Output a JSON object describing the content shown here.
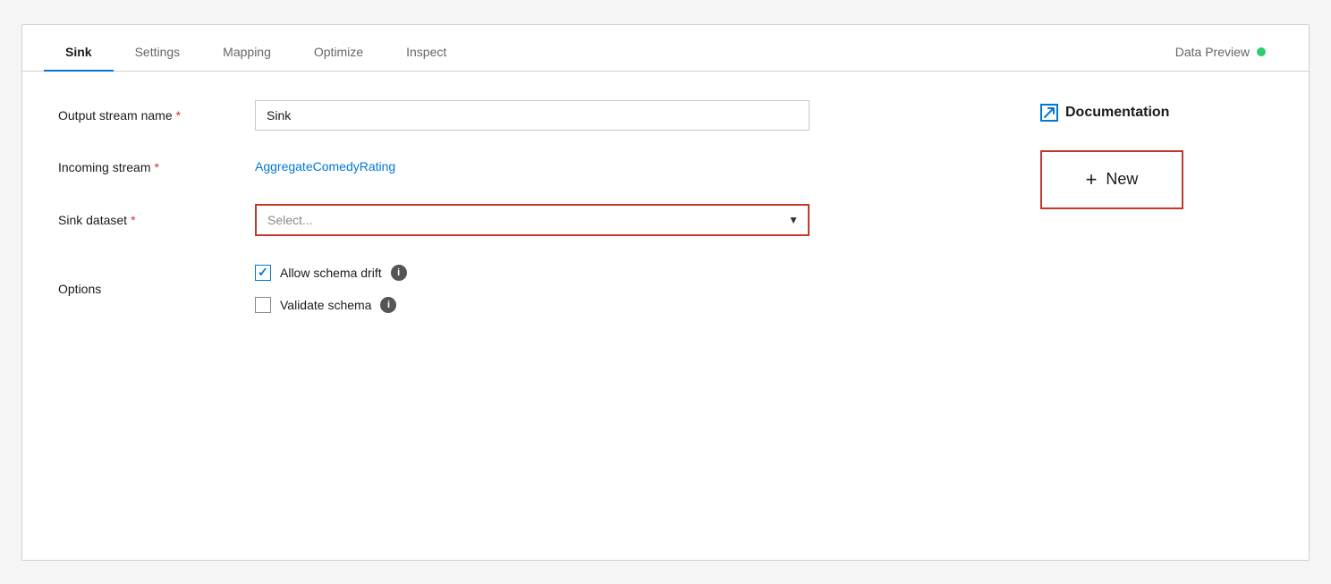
{
  "tabs": [
    {
      "id": "sink",
      "label": "Sink",
      "active": true
    },
    {
      "id": "settings",
      "label": "Settings",
      "active": false
    },
    {
      "id": "mapping",
      "label": "Mapping",
      "active": false
    },
    {
      "id": "optimize",
      "label": "Optimize",
      "active": false
    },
    {
      "id": "inspect",
      "label": "Inspect",
      "active": false
    },
    {
      "id": "data-preview",
      "label": "Data Preview",
      "active": false
    }
  ],
  "data_preview_dot_color": "#2ecc71",
  "form": {
    "output_stream_label": "Output stream name",
    "output_stream_required": "*",
    "output_stream_value": "Sink",
    "incoming_stream_label": "Incoming stream",
    "incoming_stream_required": "*",
    "incoming_stream_value": "AggregateComedyRating",
    "sink_dataset_label": "Sink dataset",
    "sink_dataset_required": "*",
    "sink_dataset_placeholder": "Select...",
    "options_label": "Options"
  },
  "checkboxes": [
    {
      "id": "allow-schema-drift",
      "label": "Allow schema drift",
      "checked": true
    },
    {
      "id": "validate-schema",
      "label": "Validate schema",
      "checked": false
    }
  ],
  "documentation": {
    "label": "Documentation",
    "icon_label": "external-link-icon"
  },
  "new_button": {
    "label": "New",
    "plus": "+"
  }
}
